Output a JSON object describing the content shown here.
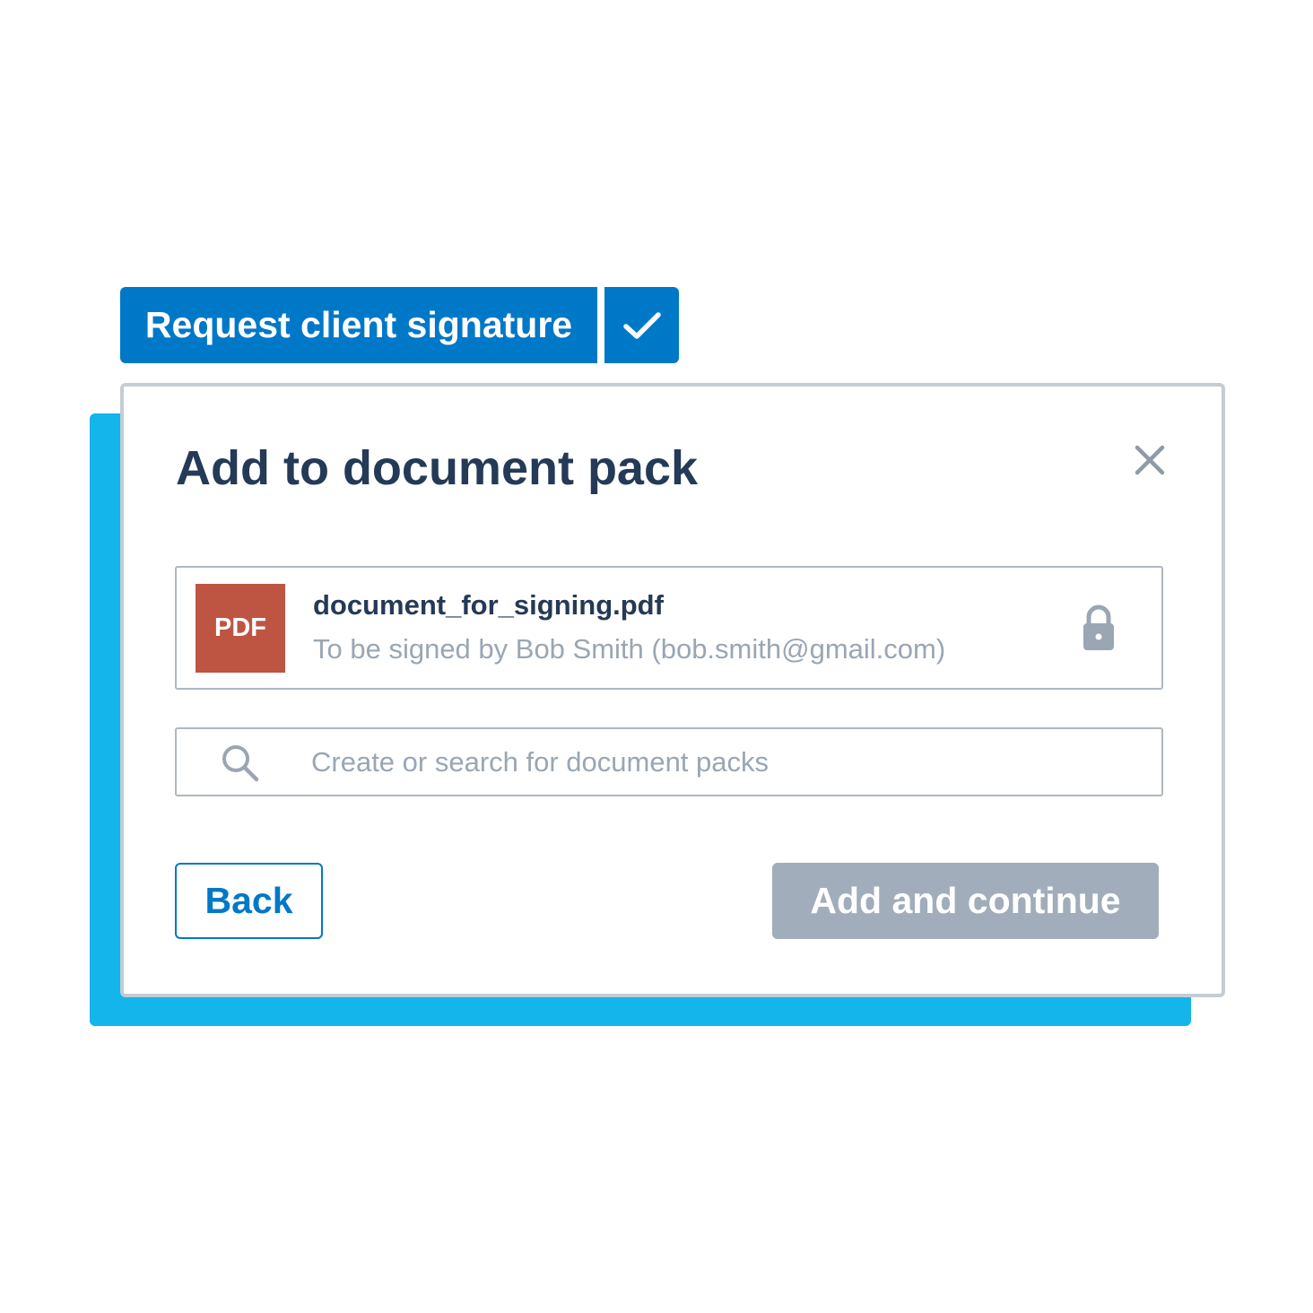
{
  "toolbar": {
    "request_label": "Request client signature",
    "confirm_icon": "check-icon"
  },
  "dialog": {
    "title": "Add to document pack",
    "close_icon": "close-icon",
    "file": {
      "badge": "PDF",
      "name": "document_for_signing.pdf",
      "meta": "To be signed by Bob Smith (bob.smith@gmail.com)",
      "status_icon": "lock-icon"
    },
    "search": {
      "placeholder": "Create or search for document packs",
      "value": ""
    },
    "actions": {
      "back_label": "Back",
      "continue_label": "Add and continue"
    }
  },
  "colors": {
    "primary": "#0078c8",
    "backdrop": "#13b5ea",
    "pdf": "#bd5542",
    "disabled": "#a1adbb",
    "heading": "#243a56",
    "muted": "#9aa6b3"
  }
}
